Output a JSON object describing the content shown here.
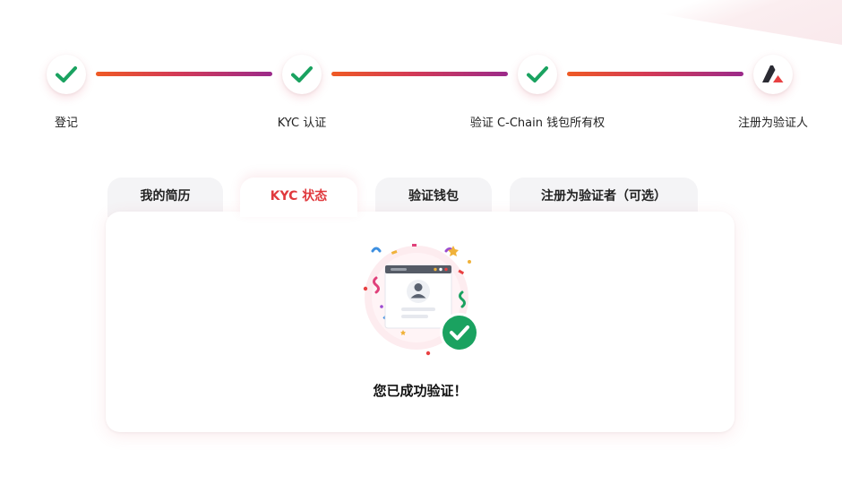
{
  "steps": [
    {
      "label": "登记",
      "icon": "check-icon",
      "status": "done"
    },
    {
      "label": "KYC 认证",
      "icon": "check-icon",
      "status": "done"
    },
    {
      "label": "验证 C-Chain 钱包所有权",
      "icon": "check-icon",
      "status": "done"
    },
    {
      "label": "注册为验证人",
      "icon": "avalanche-logo-icon",
      "status": "current"
    }
  ],
  "tabs": [
    {
      "label": "我的简历",
      "active": false
    },
    {
      "label": "KYC 状态",
      "active": true
    },
    {
      "label": "验证钱包",
      "active": false
    },
    {
      "label": "注册为验证者（可选）",
      "active": false
    }
  ],
  "panel": {
    "message": "您已成功验证！",
    "illustration_icon": "verified-profile-icon"
  },
  "colors": {
    "check": "#1aa260",
    "accent_red": "#e03a3e",
    "line_start": "#ef5a24",
    "line_end": "#9b2a8a",
    "tab_bg": "#f4f4f6"
  }
}
